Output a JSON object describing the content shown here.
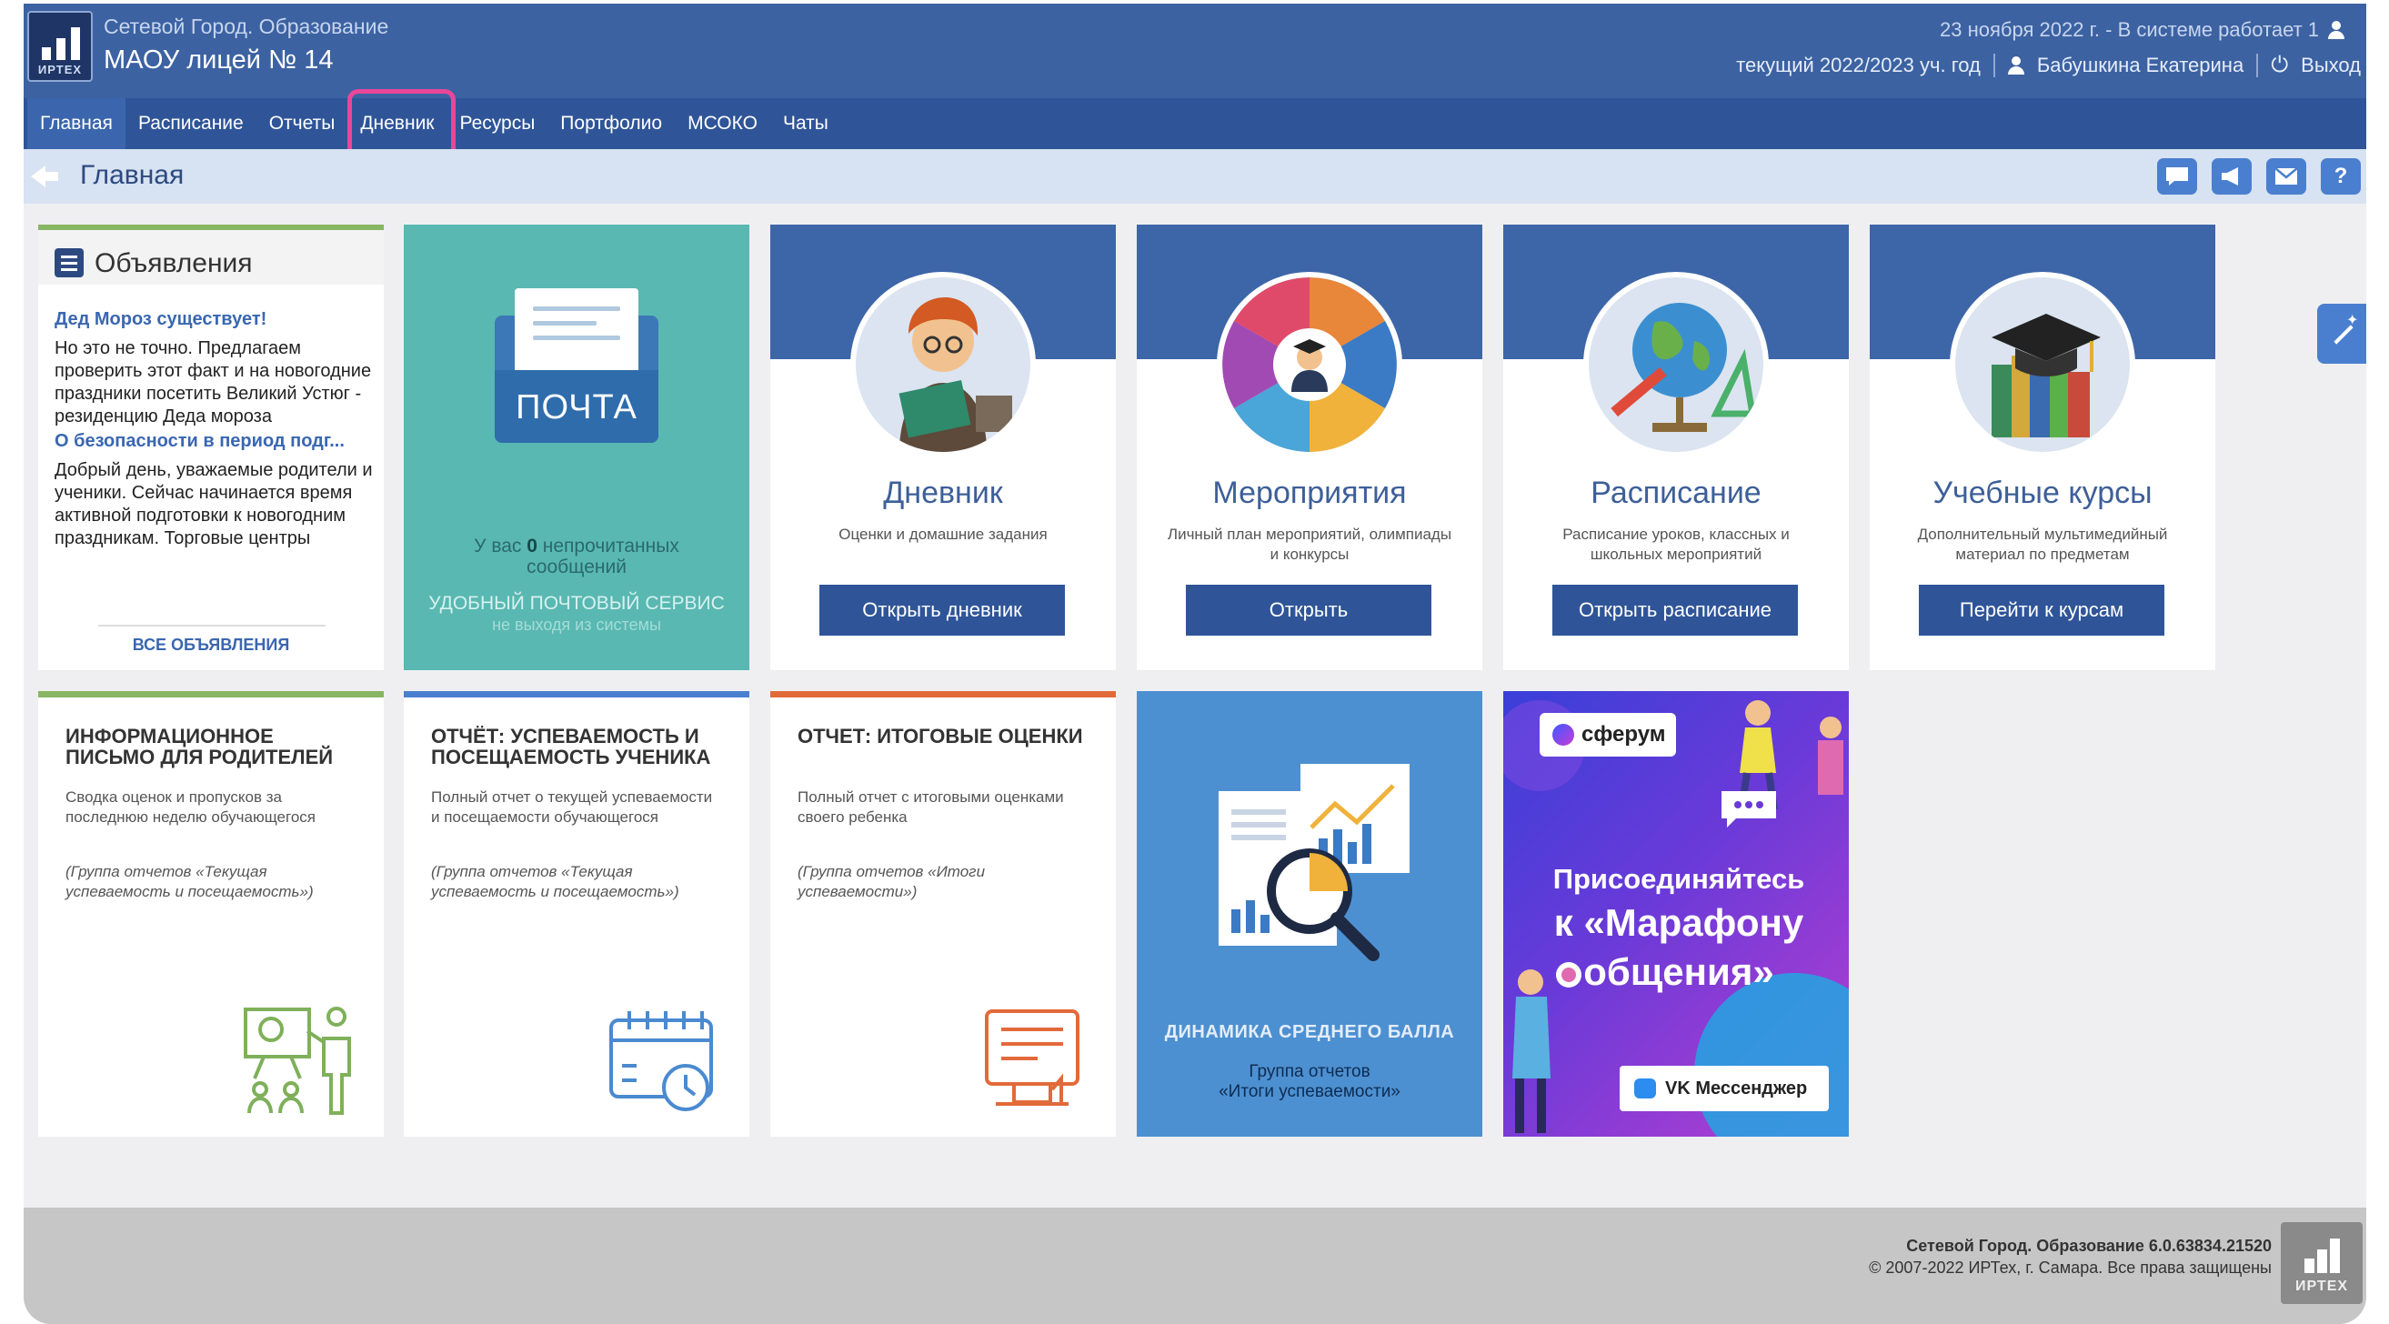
{
  "header": {
    "system_name": "Сетевой Город. Образование",
    "school_name": "МАОУ лицей № 14",
    "date_status": "23 ноября 2022 г. - В системе работает 1",
    "year": "текущий 2022/2023 уч. год",
    "user_name": "Бабушкина Екатерина",
    "logout": "Выход",
    "logo_text": "ИРТЕХ"
  },
  "nav": {
    "items": [
      "Главная",
      "Расписание",
      "Отчеты",
      "Дневник",
      "Ресурсы",
      "Портфолио",
      "МСОКО",
      "Чаты"
    ],
    "active": "Главная",
    "highlighted": "Дневник"
  },
  "breadcrumb": {
    "title": "Главная"
  },
  "toolbar": {
    "help_label": "?"
  },
  "announcements": {
    "title": "Объявления",
    "items": [
      {
        "title": "Дед Мороз существует!",
        "text": "Но это не точно. Предлагаем проверить этот факт и на новогодние праздники посетить Великий Устюг - резиденцию Деда мороза"
      },
      {
        "title": "О безопасности в период подг...",
        "text": "Добрый день, уважаемые родители и ученики. Сейчас начинается время активной подготовки к новогодним праздникам. Торговые центры"
      }
    ],
    "all_link": "ВСЕ ОБЪЯВЛЕНИЯ"
  },
  "mail": {
    "envelope_label": "ПОЧТА",
    "unread_prefix": "У вас ",
    "unread_count": "0",
    "unread_suffix": " непрочитанных сообщений",
    "service": "УДОБНЫЙ ПОЧТОВЫЙ СЕРВИС",
    "service_sub": "не выходя из системы"
  },
  "tiles": [
    {
      "title": "Дневник",
      "desc": "Оценки и домашние задания",
      "button": "Открыть дневник"
    },
    {
      "title": "Мероприятия",
      "desc": "Личный план мероприятий, олимпиады и конкурсы",
      "button": "Открыть"
    },
    {
      "title": "Расписание",
      "desc": "Расписание уроков, классных и школьных мероприятий",
      "button": "Открыть расписание"
    },
    {
      "title": "Учебные курсы",
      "desc": "Дополнительный мультимедийный материал по предметам",
      "button": "Перейти к курсам"
    }
  ],
  "reports": [
    {
      "title": "ИНФОРМАЦИОННОЕ ПИСЬМО ДЛЯ РОДИТЕЛЕЙ",
      "desc": "Сводка оценок и пропусков за последнюю неделю обучающегося",
      "group": "(Группа отчетов «Текущая успеваемость и посещаемость»)",
      "color": "#88b662"
    },
    {
      "title": "ОТЧЁТ: УСПЕВАЕМОСТЬ И ПОСЕЩАЕМОСТЬ УЧЕНИКА",
      "desc": "Полный отчет о текущей успеваемости и посещаемости обучающегося",
      "group": "(Группа отчетов «Текущая успеваемость и посещаемость»)",
      "color": "#4a7fcf"
    },
    {
      "title": "ОТЧЕТ: ИТОГОВЫЕ ОЦЕНКИ",
      "desc": "Полный отчет с итоговыми оценками своего ребенка",
      "group": "(Группа отчетов «Итоги успеваемости»)",
      "color": "#e26a3a"
    }
  ],
  "dynamics": {
    "title": "ДИНАМИКА СРЕДНЕГО БАЛЛА",
    "subtitle_line1": "Группа отчетов",
    "subtitle_line2": "«Итоги успеваемости»"
  },
  "ad": {
    "logo": "сферум",
    "line1": "Присоединяйтесь",
    "line2": "к «Марафону",
    "line3": "общения»",
    "vk": "VK Мессенджер"
  },
  "footer": {
    "version": "Сетевой Город. Образование 6.0.63834.21520",
    "copyright": "© 2007-2022 ИРТех, г. Самара. Все права защищены",
    "logo_text": "ИРТЕХ"
  },
  "colors": {
    "header": "#3c62a2",
    "nav": "#2f5598",
    "highlight": "#e8479a",
    "mail_tile": "#59b8b2",
    "dynamics_tile": "#4d90d1"
  }
}
